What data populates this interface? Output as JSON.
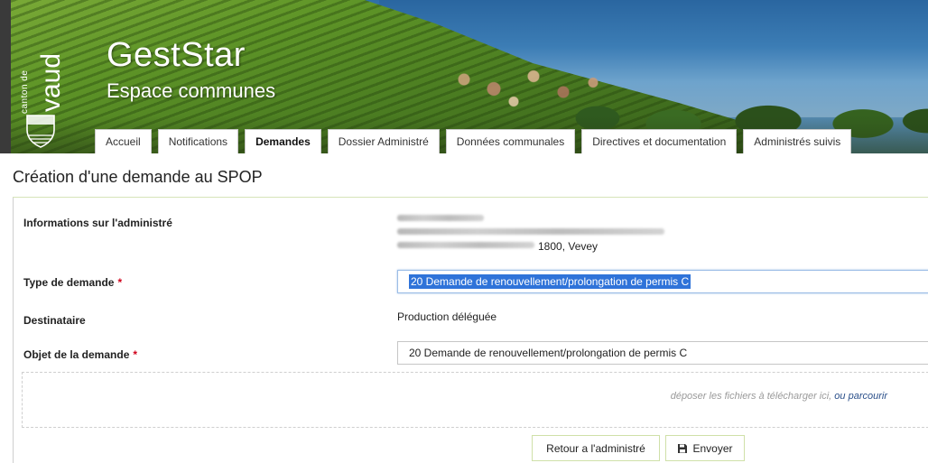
{
  "header": {
    "logo": {
      "canton_label": "canton de",
      "name": "vaud"
    },
    "app_title": "GestStar",
    "app_subtitle": "Espace communes"
  },
  "nav": {
    "tabs": [
      {
        "label": "Accueil",
        "active": false
      },
      {
        "label": "Notifications",
        "active": false
      },
      {
        "label": "Demandes",
        "active": true
      },
      {
        "label": "Dossier Administré",
        "active": false
      },
      {
        "label": "Données communales",
        "active": false
      },
      {
        "label": "Directives et documentation",
        "active": false
      },
      {
        "label": "Administrés suivis",
        "active": false
      }
    ]
  },
  "page": {
    "title": "Création d'une demande au SPOP"
  },
  "form": {
    "administre_label": "Informations sur l'administré",
    "administre_address_tail": "1800, Vevey",
    "type_label": "Type de demande",
    "type_value": "20 Demande de renouvellement/prolongation de permis C",
    "destinataire_label": "Destinataire",
    "destinataire_value": "Production déléguée",
    "objet_label": "Objet de la demande",
    "objet_value": "20 Demande de renouvellement/prolongation de permis C",
    "required_marker": "*"
  },
  "dropzone": {
    "text": "déposer les fichiers à télécharger ici,",
    "link": "ou parcourir"
  },
  "actions": {
    "back_label": "Retour a l'administré",
    "send_label": "Envoyer"
  },
  "colors": {
    "selection": "#2f73d9",
    "required": "#d0021b",
    "button_border": "#cfe0a8",
    "link": "#2a4f8a"
  }
}
